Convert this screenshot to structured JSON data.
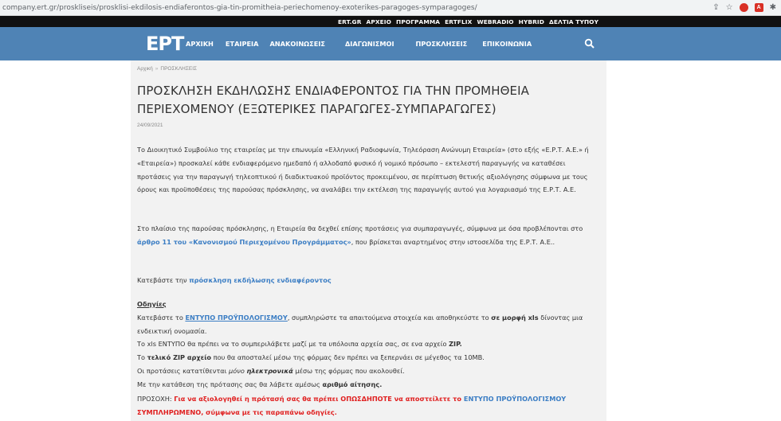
{
  "browser": {
    "url": "company.ert.gr/proskliseis/prosklisi-ekdilosis-endiaferontos-gia-tin-promitheia-periechomenoy-exoterikes-paragoges-symparagoges/"
  },
  "topbar": {
    "links": [
      "ERT.GR",
      "ΑΡΧΕΙΟ",
      "ΠΡΟΓΡΑΜΜΑ",
      "ERTFLIX",
      "WEBRADIO",
      "HYBRID",
      "ΔΕΛΤΙΑ ΤΥΠΟΥ"
    ]
  },
  "nav": {
    "logo": "ΕΡΤ",
    "links": [
      "ΑΡΧΙΚΗ",
      "ΕΤΑΙΡΕΙΑ",
      "ΑΝΑΚΟΙΝΩΣΕΙΣ",
      "ΔΙΑΓΩΝΙΣΜΟΙ",
      "ΠΡΟΣΚΛΗΣΕΙΣ",
      "ΕΠΙΚΟΙΝΩΝΙΑ"
    ]
  },
  "breadcrumb": {
    "home": "Αρχική",
    "sep": "»",
    "current": "ΠΡΟΣΚΛΗΣΕΙΣ"
  },
  "article": {
    "title": "ΠΡΟΣΚΛΗΣΗ ΕΚΔΗΛΩΣΗΣ ΕΝΔΙΑΦΕΡΟΝΤΟΣ ΓΙΑ ΤΗΝ ΠΡΟΜΗΘΕΙΑ ΠΕΡΙΕΧΟΜΕΝΟΥ (ΕΞΩΤΕΡΙΚΕΣ ΠΑΡΑΓΩΓΕΣ-ΣΥΜΠΑΡΑΓΩΓΕΣ)",
    "date": "24/09/2021",
    "p1": "Το Διοικητικό Συμβούλιο της εταιρείας με την επωνυμία «Ελληνική Ραδιοφωνία, Τηλεόραση Ανώνυμη Εταιρεία» (στο εξής «Ε.Ρ.Τ. Α.Ε.» ή «Εταιρεία») προσκαλεί κάθε ενδιαφερόμενο ημεδαπό ή αλλοδαπό φυσικό ή νομικό πρόσωπο – εκτελεστή παραγωγής να καταθέσει προτάσεις για την παραγωγή τηλεοπτικού ή διαδικτυακού προϊόντος προκειμένου, σε περίπτωση θετικής αξιολόγησης σύμφωνα με τους όρους και προϋποθέσεις  της παρούσας πρόσκλησης, να αναλάβει την εκτέλεση της παραγωγής αυτού για λογαριασμό της Ε.Ρ.Τ. Α.Ε.",
    "p2_before": "Στο πλαίσιο της παρούσας πρόσκλησης, η Εταιρεία θα δεχθεί επίσης προτάσεις για συμπαραγωγές, σύμφωνα με όσα προβλέπονται στο ",
    "p2_link": "άρθρο 11 του «Κανονισμού Περιεχομένου Προγράμματος»",
    "p2_after": ", που βρίσκεται αναρτημένος στην ιστοσελίδα της Ε.Ρ.Τ. Α.Ε..",
    "p3_before": "Κατεβάστε την ",
    "p3_link": "πρόσκληση εκδήλωσης ενδιαφέροντος",
    "instructions_header": "Οδηγίες",
    "i1_before": "Κατεβάστε το ",
    "i1_link": "ΕΝΤΥΠΟ ΠΡΟΫΠΟΛΟΓΙΣΜΟΥ",
    "i1_mid": ", συμπληρώστε τα απαιτούμενα στοιχεία και αποθηκεύστε το ",
    "i1_bold": "σε μορφή xls",
    "i1_after": " δίνοντας μια ενδεικτική ονομασία.",
    "i2_before": "Το xls ΕΝΤΥΠΟ θα πρέπει να το συμπεριλάβετε μαζί με τα υπόλοιπα αρχεία σας, σε ενα αρχείο ",
    "i2_bold": "ZIP.",
    "i3_before": "Το ",
    "i3_bold": "τελικό ZIP αρχείο",
    "i3_after": " που θα αποσταλεί μέσω της φόρμας δεν πρέπει να ξεπερνάει σε μέγεθος τα 10MB.",
    "i4_before": "Οι προτάσεις κατατίθενται ",
    "i4_em": "μόνο",
    "i4_space": " ",
    "i4_bem": "ηλεκτρονικά",
    "i4_after": " μέσω της φόρμας που ακολουθεί.",
    "i5_before": "Με την κατάθεση της πρότασης σας θα λάβετε αμέσως ",
    "i5_bold": "αριθμό αίτησης.",
    "warn_label": "ΠΡΟΣΟΧΗ: ",
    "warn_red": "Για να αξιολογηθεί η πρότασή σας θα πρέπει ΟΠΩΣΔΗΠΟΤΕ να αποστείλετε το ",
    "warn_blue": "ΕΝΤΥΠΟ ΠΡΟΫΠΟΛΟΓΙΣΜΟΥ",
    "warn_red2": "ΣΥΜΠΛΗΡΩΜΕΝΟ, σύμφωνα με τις παραπάνω οδηγίες."
  },
  "colors": {
    "nav": "#4f83b5",
    "link": "#3c7ec4",
    "warn": "#e02020"
  }
}
